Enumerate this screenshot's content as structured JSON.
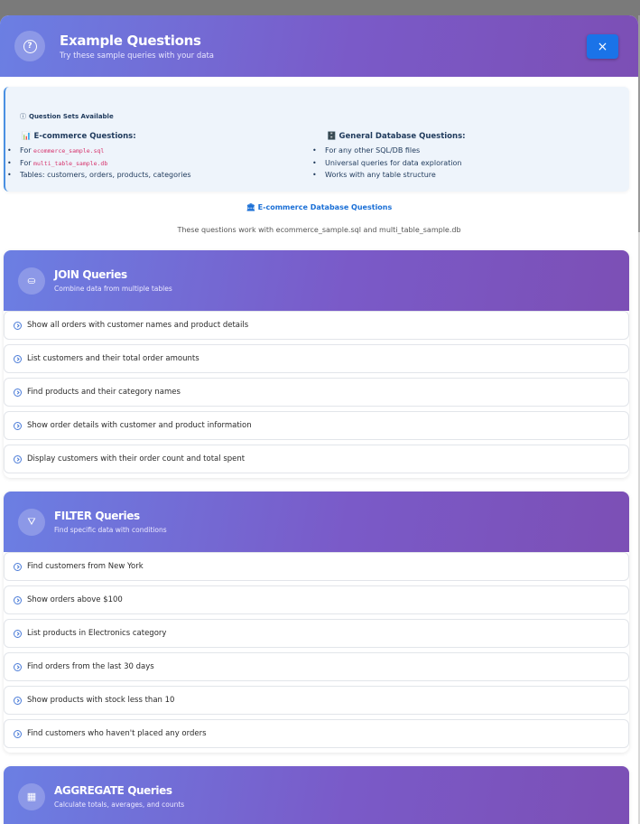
{
  "header": {
    "title": "Example Questions",
    "subtitle": "Try these sample queries with your data",
    "close_label": "×"
  },
  "info": {
    "title": "Question Sets Available",
    "ecommerce": {
      "heading": "📊 E-commerce Questions:",
      "for_prefix": "For",
      "file1": "ecommerce_sample.sql",
      "file2": "multi_table_sample.db",
      "tables": "Tables: customers, orders, products, categories"
    },
    "general": {
      "heading": "🗄️ General Database Questions:",
      "items": [
        "For any other SQL/DB files",
        "Universal queries for data exploration",
        "Works with any table structure"
      ]
    }
  },
  "section": {
    "link": "🏛 E-commerce Database Questions",
    "description": "These questions work with ecommerce_sample.sql and multi_table_sample.db"
  },
  "cards": {
    "join": {
      "icon": "⛀",
      "title": "JOIN Queries",
      "subtitle": "Combine data from multiple tables",
      "questions": [
        "Show all orders with customer names and product details",
        "List customers and their total order amounts",
        "Find products and their category names",
        "Show order details with customer and product information",
        "Display customers with their order count and total spent"
      ]
    },
    "filter": {
      "icon": "⛛",
      "title": "FILTER Queries",
      "subtitle": "Find specific data with conditions",
      "questions": [
        "Find customers from New York",
        "Show orders above $100",
        "List products in Electronics category",
        "Find orders from the last 30 days",
        "Show products with stock less than 10",
        "Find customers who haven't placed any orders"
      ]
    },
    "aggregate": {
      "icon": "▦",
      "title": "AGGREGATE Queries",
      "subtitle": "Calculate totals, averages, and counts"
    }
  }
}
